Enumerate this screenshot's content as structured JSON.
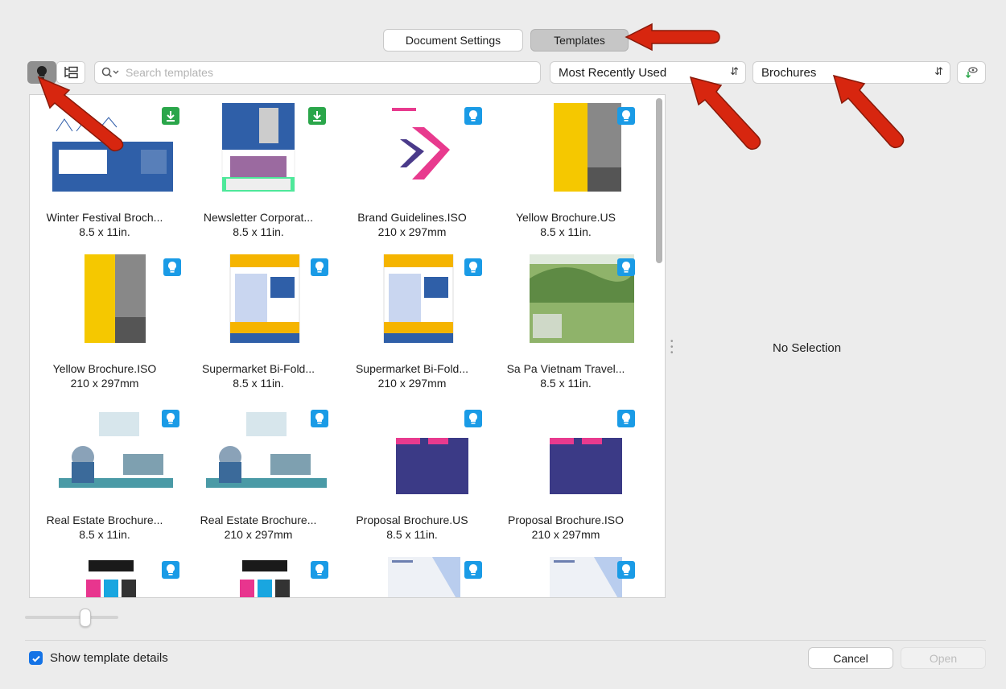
{
  "tabs": {
    "document_settings": "Document Settings",
    "templates": "Templates"
  },
  "search": {
    "placeholder": "Search templates"
  },
  "sort": {
    "selected": "Most Recently Used"
  },
  "category": {
    "selected": "Brochures"
  },
  "templates": [
    {
      "name": "Winter Festival Broch...",
      "size": "8.5 x 11in.",
      "badge": "download"
    },
    {
      "name": "Newsletter Corporat...",
      "size": "8.5 x 11in.",
      "badge": "download"
    },
    {
      "name": "Brand Guidelines.ISO",
      "size": "210 x 297mm",
      "badge": "tip"
    },
    {
      "name": "Yellow Brochure.US",
      "size": "8.5 x 11in.",
      "badge": "tip"
    },
    {
      "name": "Yellow Brochure.ISO",
      "size": "210 x 297mm",
      "badge": "tip"
    },
    {
      "name": "Supermarket Bi-Fold...",
      "size": "8.5 x 11in.",
      "badge": "tip"
    },
    {
      "name": "Supermarket Bi-Fold...",
      "size": "210 x 297mm",
      "badge": "tip"
    },
    {
      "name": "Sa Pa Vietnam Travel...",
      "size": "8.5 x 11in.",
      "badge": "tip"
    },
    {
      "name": "Real Estate Brochure...",
      "size": "8.5 x 11in.",
      "badge": "tip"
    },
    {
      "name": "Real Estate Brochure...",
      "size": "210 x 297mm",
      "badge": "tip"
    },
    {
      "name": "Proposal Brochure.US",
      "size": "8.5 x 11in.",
      "badge": "tip"
    },
    {
      "name": "Proposal Brochure.ISO",
      "size": "210 x 297mm",
      "badge": "tip"
    },
    {
      "name": "",
      "size": "",
      "badge": "tip"
    },
    {
      "name": "",
      "size": "",
      "badge": "tip"
    },
    {
      "name": "",
      "size": "",
      "badge": "tip"
    },
    {
      "name": "",
      "size": "",
      "badge": "tip"
    }
  ],
  "detail_panel": {
    "empty_text": "No Selection"
  },
  "footer": {
    "show_details_label": "Show template details",
    "show_details_checked": true,
    "cancel": "Cancel",
    "open": "Open"
  },
  "colors": {
    "badge_tip": "#1a9be6",
    "badge_download": "#2aa64a",
    "accent": "#1473e6",
    "arrow": "#d7260f"
  }
}
